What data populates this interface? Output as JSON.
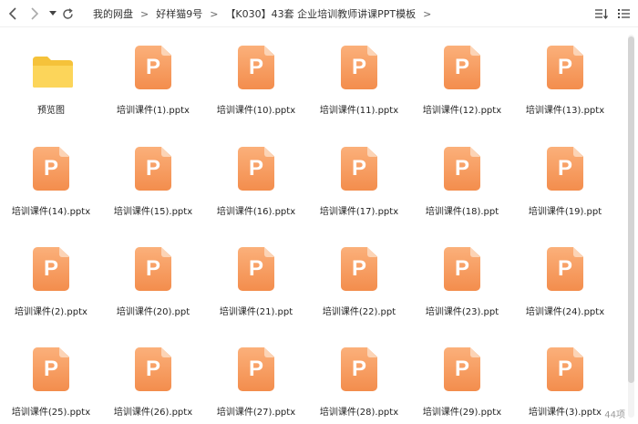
{
  "breadcrumb": [
    {
      "label": "我的网盘"
    },
    {
      "label": "好样猫9号"
    },
    {
      "label": "【K030】43套 企业培训教师讲课PPT模板"
    }
  ],
  "files": [
    {
      "name": "预览图",
      "type": "folder"
    },
    {
      "name": "培训课件(1).pptx",
      "type": "ppt"
    },
    {
      "name": "培训课件(10).pptx",
      "type": "ppt"
    },
    {
      "name": "培训课件(11).pptx",
      "type": "ppt"
    },
    {
      "name": "培训课件(12).pptx",
      "type": "ppt"
    },
    {
      "name": "培训课件(13).pptx",
      "type": "ppt"
    },
    {
      "name": "培训课件(14).pptx",
      "type": "ppt"
    },
    {
      "name": "培训课件(15).pptx",
      "type": "ppt"
    },
    {
      "name": "培训课件(16).pptx",
      "type": "ppt"
    },
    {
      "name": "培训课件(17).pptx",
      "type": "ppt"
    },
    {
      "name": "培训课件(18).ppt",
      "type": "ppt"
    },
    {
      "name": "培训课件(19).ppt",
      "type": "ppt"
    },
    {
      "name": "培训课件(2).pptx",
      "type": "ppt"
    },
    {
      "name": "培训课件(20).ppt",
      "type": "ppt"
    },
    {
      "name": "培训课件(21).ppt",
      "type": "ppt"
    },
    {
      "name": "培训课件(22).ppt",
      "type": "ppt"
    },
    {
      "name": "培训课件(23).ppt",
      "type": "ppt"
    },
    {
      "name": "培训课件(24).pptx",
      "type": "ppt"
    },
    {
      "name": "培训课件(25).pptx",
      "type": "ppt"
    },
    {
      "name": "培训课件(26).pptx",
      "type": "ppt"
    },
    {
      "name": "培训课件(27).pptx",
      "type": "ppt"
    },
    {
      "name": "培训课件(28).pptx",
      "type": "ppt"
    },
    {
      "name": "培训课件(29).pptx",
      "type": "ppt"
    },
    {
      "name": "培训课件(3).pptx",
      "type": "ppt"
    }
  ],
  "ppt_icon_letter": "P",
  "item_count": "44项",
  "colors": {
    "ppt_icon": "#f59a5c",
    "folder": "#fcd24a",
    "text": "#222222",
    "muted": "#9a9a9a"
  },
  "icons": {
    "back": "chevron-left-icon",
    "forward": "chevron-right-icon",
    "history": "caret-down-icon",
    "refresh": "refresh-icon",
    "sort": "sort-icon",
    "view": "list-view-icon"
  }
}
